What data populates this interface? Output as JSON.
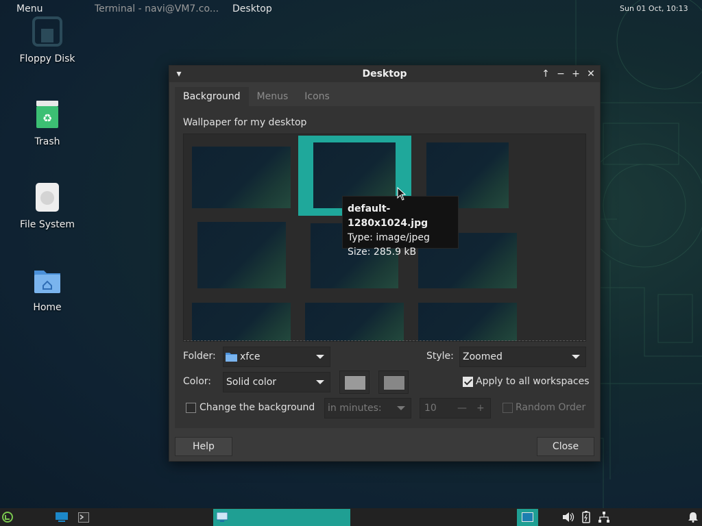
{
  "desktop_icons": [
    {
      "label": "Floppy Disk",
      "icon": "floppy-disk-icon"
    },
    {
      "label": "Trash",
      "icon": "trash-icon"
    },
    {
      "label": "File System",
      "icon": "hard-drive-icon"
    },
    {
      "label": "Home",
      "icon": "home-folder-icon"
    }
  ],
  "window": {
    "title": "Desktop",
    "tabs": [
      {
        "label": "Background",
        "active": true
      },
      {
        "label": "Menus",
        "active": false
      },
      {
        "label": "Icons",
        "active": false
      }
    ],
    "wallpaper_heading": "Wallpaper for my desktop",
    "tooltip": {
      "name": "default-1280x1024.jpg",
      "type": "Type: image/jpeg",
      "size": "Size: 285.9 kB"
    },
    "folder_label": "Folder:",
    "folder_value": "xfce",
    "style_label": "Style:",
    "style_value": "Zoomed",
    "color_label": "Color:",
    "color_value": "Solid color",
    "color_swatches": [
      "#9a9a9a",
      "#8a8a8a"
    ],
    "apply_all_label": "Apply to all workspaces",
    "apply_all_checked": true,
    "change_bg_label": "Change the background",
    "change_bg_checked": false,
    "interval_unit": "in minutes:",
    "interval_value": "10",
    "random_order_label": "Random Order",
    "random_order_checked": false,
    "help_label": "Help",
    "close_label": "Close"
  },
  "taskbar": {
    "menu_label": "Menu",
    "tasks": [
      {
        "label": "Terminal - navi@VM7.co...",
        "active": false
      },
      {
        "label": "Desktop",
        "active": true
      }
    ],
    "clock": "Sun 01 Oct, 10:13"
  },
  "colors": {
    "accent": "#1fa89b",
    "window_bg": "#3a3a3a",
    "taskbar_bg": "#222222"
  }
}
